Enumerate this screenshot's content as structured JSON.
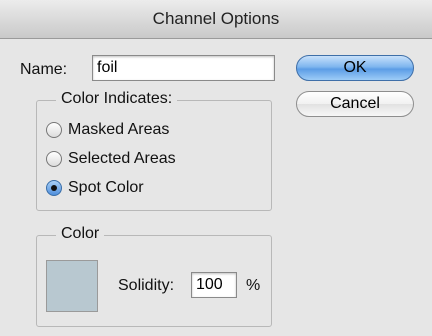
{
  "window": {
    "title": "Channel Options"
  },
  "name_field": {
    "label": "Name:",
    "value": "foil"
  },
  "buttons": {
    "ok": "OK",
    "cancel": "Cancel"
  },
  "color_indicates": {
    "legend": "Color Indicates:",
    "options": [
      {
        "label": "Masked Areas",
        "checked": false
      },
      {
        "label": "Selected Areas",
        "checked": false
      },
      {
        "label": "Spot Color",
        "checked": true
      }
    ]
  },
  "color_group": {
    "legend": "Color",
    "swatch_color": "#b8c8d0",
    "solidity_label": "Solidity:",
    "solidity_value": "100",
    "solidity_unit": "%"
  }
}
